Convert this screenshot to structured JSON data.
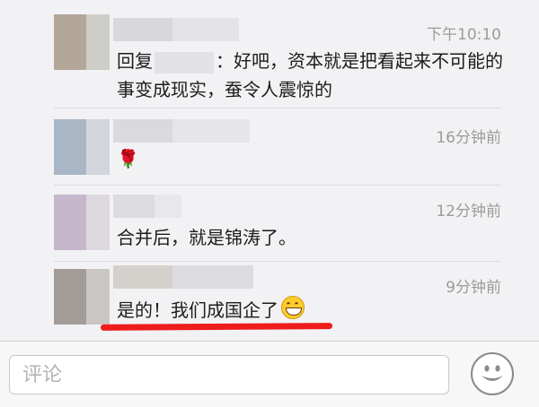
{
  "comments": [
    {
      "time": "下午10:10",
      "text_prefix": "回复",
      "text_suffix": "：好吧，资本就是把看起来不可能的事变成现实，蚕令人震惊的",
      "avatar_colors": [
        "#b3a79a",
        "#cfcdc9"
      ],
      "name_colors": [
        "#d8d8dc",
        "#e4e4e8"
      ]
    },
    {
      "time": "16分钟前",
      "text": "🌹",
      "avatar_colors": [
        "#a9b6c6",
        "#d2d6dc"
      ],
      "name_colors": [
        "#dadade",
        "#e6e6ea"
      ]
    },
    {
      "time": "12分钟前",
      "text": "合并后，就是锦涛了。",
      "avatar_colors": [
        "#c6b8cc",
        "#dcd8de"
      ],
      "name_colors": [
        "#dcdce0",
        "#e8e8ec"
      ]
    },
    {
      "time": "9分钟前",
      "text": "是的！我们成国企了",
      "avatar_colors": [
        "#a29b98",
        "#c9c6c4"
      ],
      "name_colors": [
        "#d4d0cc",
        "#dcdce0"
      ]
    }
  ],
  "comment_bar": {
    "placeholder": "评论",
    "emoji_button": "smiley-icon"
  },
  "colors": {
    "highlight_underline": "#ee1c1c",
    "time_text": "#9b9b9b"
  }
}
